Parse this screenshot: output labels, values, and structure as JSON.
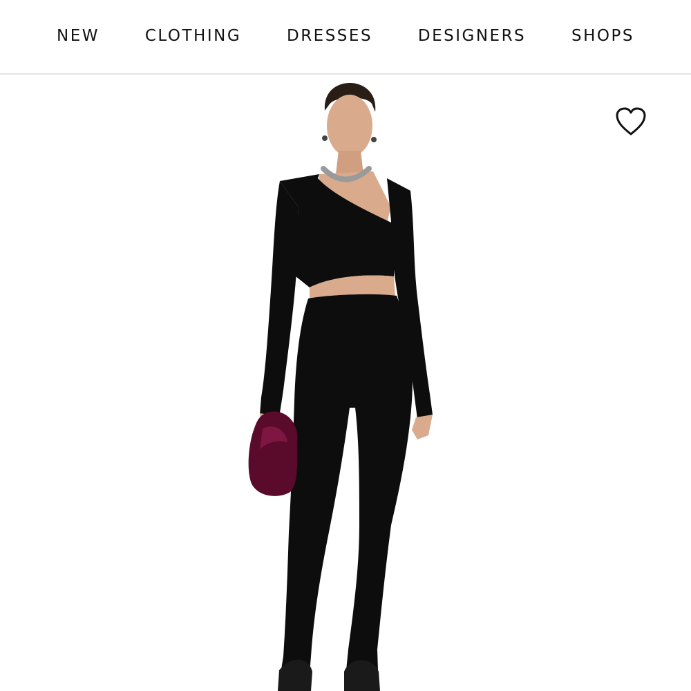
{
  "nav": {
    "items": [
      {
        "label": "NEW"
      },
      {
        "label": "CLOTHING"
      },
      {
        "label": "DRESSES"
      },
      {
        "label": "DESIGNERS"
      },
      {
        "label": "SHOPS"
      }
    ]
  },
  "product": {
    "image_icon": "fashion-model-photo",
    "wishlist_icon": "heart-outline-icon"
  },
  "colors": {
    "text": "#111111",
    "divider": "#e4e4e4",
    "garment": "#0d0d0d",
    "bag": "#5a0a2a",
    "skin": "#d9ab8c"
  }
}
